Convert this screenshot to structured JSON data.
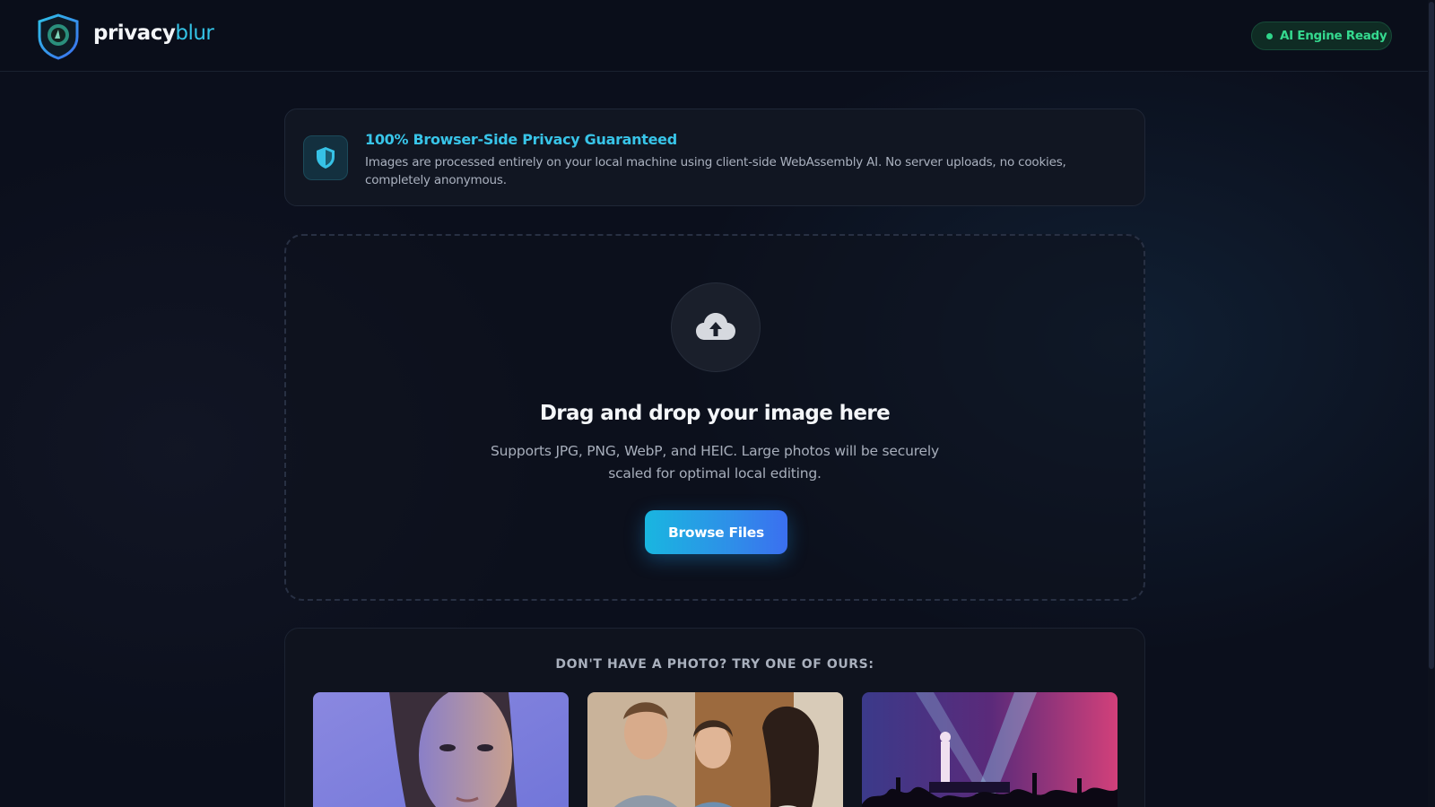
{
  "header": {
    "brand_main": "privacy",
    "brand_accent": "blur",
    "logo_icon": "shield-eye-icon",
    "status_label": "AI Engine Ready",
    "status_color": "#35d98f"
  },
  "privacy_banner": {
    "icon": "shield-icon",
    "title": "100% Browser-Side Privacy Guaranteed",
    "description": "Images are processed entirely on your local machine using client-side WebAssembly AI. No server uploads, no cookies, completely anonymous."
  },
  "dropzone": {
    "icon": "cloud-upload-icon",
    "title": "Drag and drop your image here",
    "description": "Supports JPG, PNG, WebP, and HEIC. Large photos will be securely scaled for optimal local editing.",
    "button_label": "Browse Files"
  },
  "samples": {
    "heading": "DON'T HAVE A PHOTO? TRY ONE OF OURS:",
    "items": [
      {
        "subject": "portrait-woman"
      },
      {
        "subject": "group-of-friends"
      },
      {
        "subject": "concert-crowd"
      }
    ]
  },
  "colors": {
    "accent": "#34c3e6",
    "background": "#0b0f1c",
    "button_gradient_start": "#19b6e0",
    "button_gradient_end": "#3b6ff0"
  }
}
